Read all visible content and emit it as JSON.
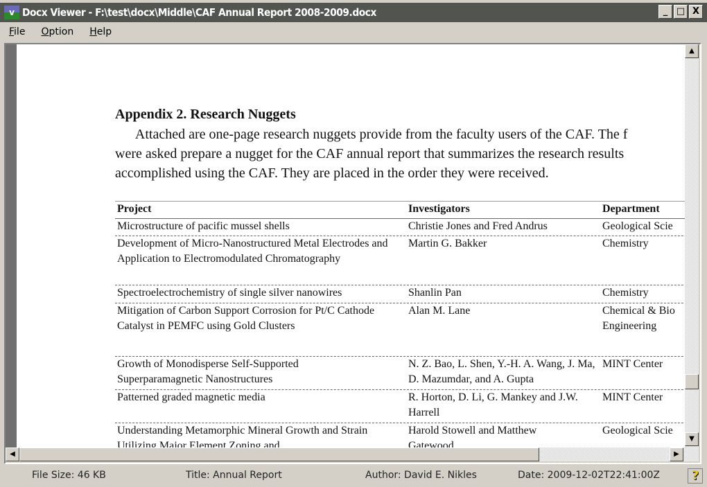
{
  "window": {
    "title": "Docx Viewer - F:\\test\\docx\\Middle\\CAF Annual Report 2008-2009.docx",
    "minimize": "_",
    "maximize": "□",
    "close": "X"
  },
  "menu": [
    {
      "label": "File",
      "key": "F",
      "rest": "ile"
    },
    {
      "label": "Option",
      "key": "O",
      "rest": "ption"
    },
    {
      "label": "Help",
      "key": "H",
      "rest": "elp"
    }
  ],
  "document": {
    "heading": "Appendix 2. Research Nuggets",
    "paragraph": "      Attached are one-page research nuggets provide from the faculty users of the CAF. The f\nwere asked prepare a nugget for the CAF annual report that summarizes the research results\naccomplished using the CAF. They are placed in the order they were received.",
    "table": {
      "headers": [
        "Project",
        "Investigators",
        "Department"
      ],
      "rows": [
        [
          "Microstructure of pacific mussel shells",
          "Christie Jones and Fred Andrus",
          "Geological Scie"
        ],
        [
          "Development of Micro-Nanostructured Metal Electrodes and Application to Electromodulated Chromatography",
          "Martin G. Bakker",
          "Chemistry"
        ],
        [
          "Spectroelectrochemistry of single silver nanowires",
          "Shanlin Pan",
          "Chemistry"
        ],
        [
          "Mitigation of Carbon Support Corrosion for Pt/C Cathode Catalyst in PEMFC using Gold Clusters",
          "Alan M. Lane",
          "Chemical & Bio Engineering"
        ],
        [
          "Growth of Monodisperse Self-Supported Superparamagnetic Nanostructures",
          "N. Z. Bao, L. Shen, Y.-H. A. Wang, J. Ma, D. Mazumdar, and A. Gupta",
          "MINT Center"
        ],
        [
          "Patterned graded magnetic media",
          "R. Horton, D. Li, G. Mankey and J.W. Harrell",
          "MINT Center"
        ],
        [
          "Understanding Metamorphic Mineral Growth and Strain Utilizing Major Element Zoning and",
          "Harold Stowell and Matthew Gatewood",
          "Geological Scie"
        ]
      ]
    }
  },
  "status": {
    "file_size": "File Size: 46 KB",
    "title": "Title: Annual Report",
    "author": "Author: David E. Nikles",
    "date": "Date: 2009-12-02T22:41:00Z",
    "help_icon": "?"
  }
}
